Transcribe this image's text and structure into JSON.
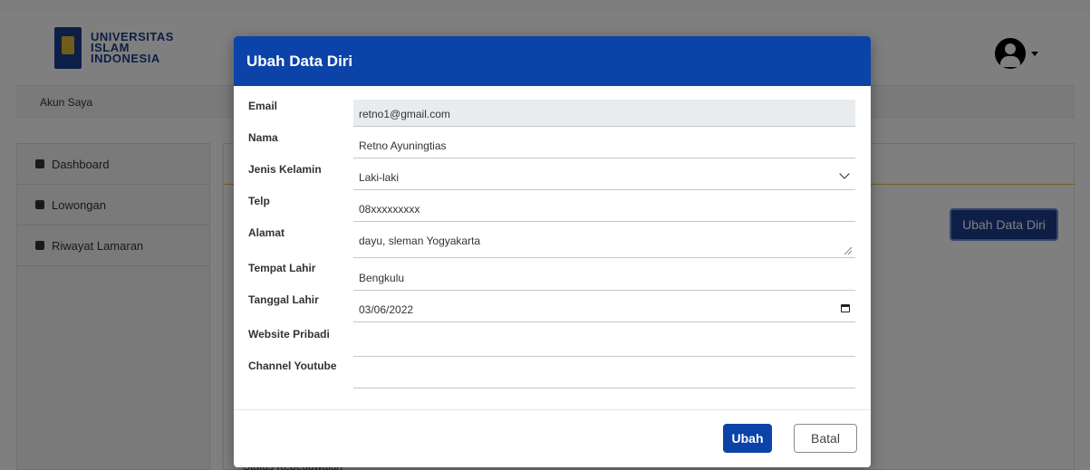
{
  "header": {
    "logo_text_1": "UNIVERSITAS",
    "logo_text_2": "ISLAM",
    "logo_text_3": "INDONESIA"
  },
  "breadcrumb": {
    "label": "Akun Saya"
  },
  "sidebar": {
    "items": [
      {
        "label": "Dashboard",
        "icon": "dashboard-icon"
      },
      {
        "label": "Lowongan",
        "icon": "briefcase-icon"
      },
      {
        "label": "Riwayat Lamaran",
        "icon": "book-icon"
      }
    ]
  },
  "main": {
    "edit_button_label": "Ubah Data Diri",
    "hidden_row_label": "Status Kepegawaian"
  },
  "modal": {
    "title": "Ubah Data Diri",
    "fields": [
      {
        "label": "Email",
        "value": "retno1@gmail.com",
        "type": "disabled"
      },
      {
        "label": "Nama",
        "value": "Retno Ayuningtias",
        "type": "text"
      },
      {
        "label": "Jenis Kelamin",
        "value": "Laki-laki",
        "type": "select"
      },
      {
        "label": "Telp",
        "value": "08xxxxxxxxx",
        "type": "text"
      },
      {
        "label": "Alamat",
        "value": "dayu, sleman Yogyakarta",
        "type": "textarea"
      },
      {
        "label": "Tempat Lahir",
        "value": "Bengkulu",
        "type": "text"
      },
      {
        "label": "Tanggal Lahir",
        "value": "03/06/2022",
        "type": "date"
      },
      {
        "label": "Website Pribadi",
        "value": "",
        "type": "text"
      },
      {
        "label": "Channel Youtube",
        "value": "",
        "type": "text"
      }
    ],
    "submit_label": "Ubah",
    "cancel_label": "Batal"
  },
  "colors": {
    "primary": "#0c43a8",
    "overlay": "#000000",
    "accent_line": "#f0b84a"
  }
}
